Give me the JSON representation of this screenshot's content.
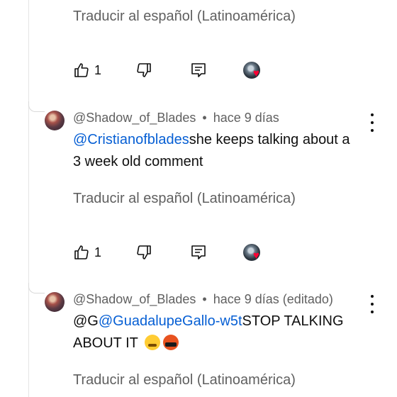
{
  "translate_label": "Traducir al español (Latinoamérica)",
  "blocks": [
    {
      "likes": "1"
    },
    {
      "comment": {
        "author": "@Shadow_of_Blades",
        "separator": "•",
        "time": "hace 9 días",
        "mention": "@Cristianofblades",
        "text": "she keeps talking about a 3 week old comment"
      },
      "likes": "1"
    },
    {
      "comment": {
        "author": "@Shadow_of_Blades",
        "separator": "•",
        "time": "hace 9 días (editado)",
        "prefix": "@G",
        "mention": "@GuadalupeGallo-w5t",
        "text": "STOP TALKING ABOUT IT"
      }
    }
  ],
  "icons": {
    "like": "thumbs-up-icon",
    "dislike": "thumbs-down-icon",
    "reply": "reply-icon",
    "creator_heart": "creator-heart-icon",
    "more": "more-vert-icon",
    "emoji_1": "face-with-steam-emoji",
    "emoji_2": "face-with-symbols-emoji"
  },
  "colors": {
    "mention": "#065fd4",
    "secondary_text": "#606060",
    "heart": "#ff0033"
  }
}
